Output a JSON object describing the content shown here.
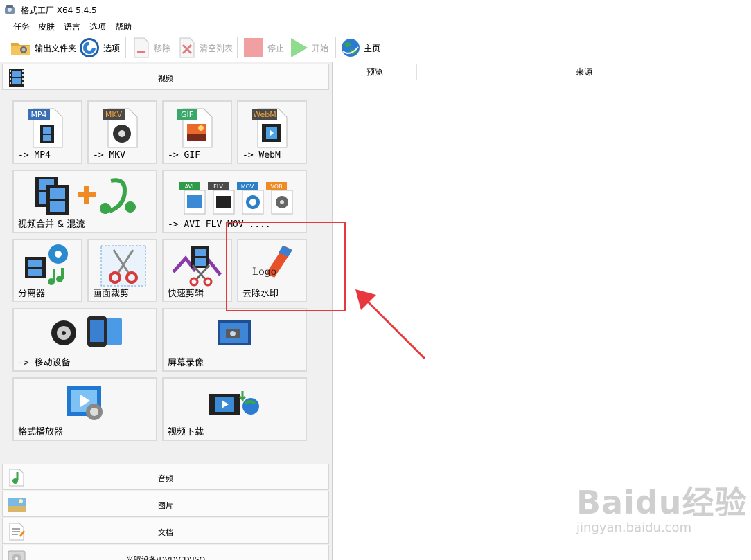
{
  "window": {
    "title": "格式工厂 X64 5.4.5"
  },
  "menu": [
    "任务",
    "皮肤",
    "语言",
    "选项",
    "帮助"
  ],
  "toolbar": {
    "output_folder": "输出文件夹",
    "options": "选项",
    "remove": "移除",
    "clear_list": "清空列表",
    "stop": "停止",
    "start": "开始",
    "home": "主页"
  },
  "categories": {
    "video": "视频",
    "audio": "音频",
    "image": "图片",
    "document": "文档",
    "disc": "光驱设备\\DVD\\CD\\ISO"
  },
  "video_tiles": {
    "mp4": {
      "label": "-> MP4",
      "badge": "MP4"
    },
    "mkv": {
      "label": "-> MKV",
      "badge": "MKV"
    },
    "gif": {
      "label": "-> GIF",
      "badge": "GIF"
    },
    "webm": {
      "label": "-> WebM",
      "badge": "WebM"
    },
    "merge": {
      "label": "视频合并 & 混流"
    },
    "formats": {
      "label": "-> AVI FLV MOV ....",
      "badges": [
        "AVI",
        "FLV",
        "MOV",
        "VOB"
      ]
    },
    "splitter": {
      "label": "分离器"
    },
    "crop": {
      "label": "画面裁剪"
    },
    "quick_cut": {
      "label": "快速剪辑"
    },
    "remove_watermark": {
      "label": "去除水印",
      "logo_text": "Logo"
    },
    "mobile": {
      "label": "-> 移动设备"
    },
    "screen_record": {
      "label": "屏幕录像"
    },
    "player": {
      "label": "格式播放器"
    },
    "download": {
      "label": "视频下载"
    }
  },
  "list_columns": [
    "预览",
    "来源"
  ],
  "watermark": {
    "brand": "Baidu经验",
    "url": "jingyan.baidu.com"
  },
  "colors": {
    "highlight": "#e8383d",
    "start_green": "#6ad26a",
    "stop_red": "#f08c8c"
  }
}
